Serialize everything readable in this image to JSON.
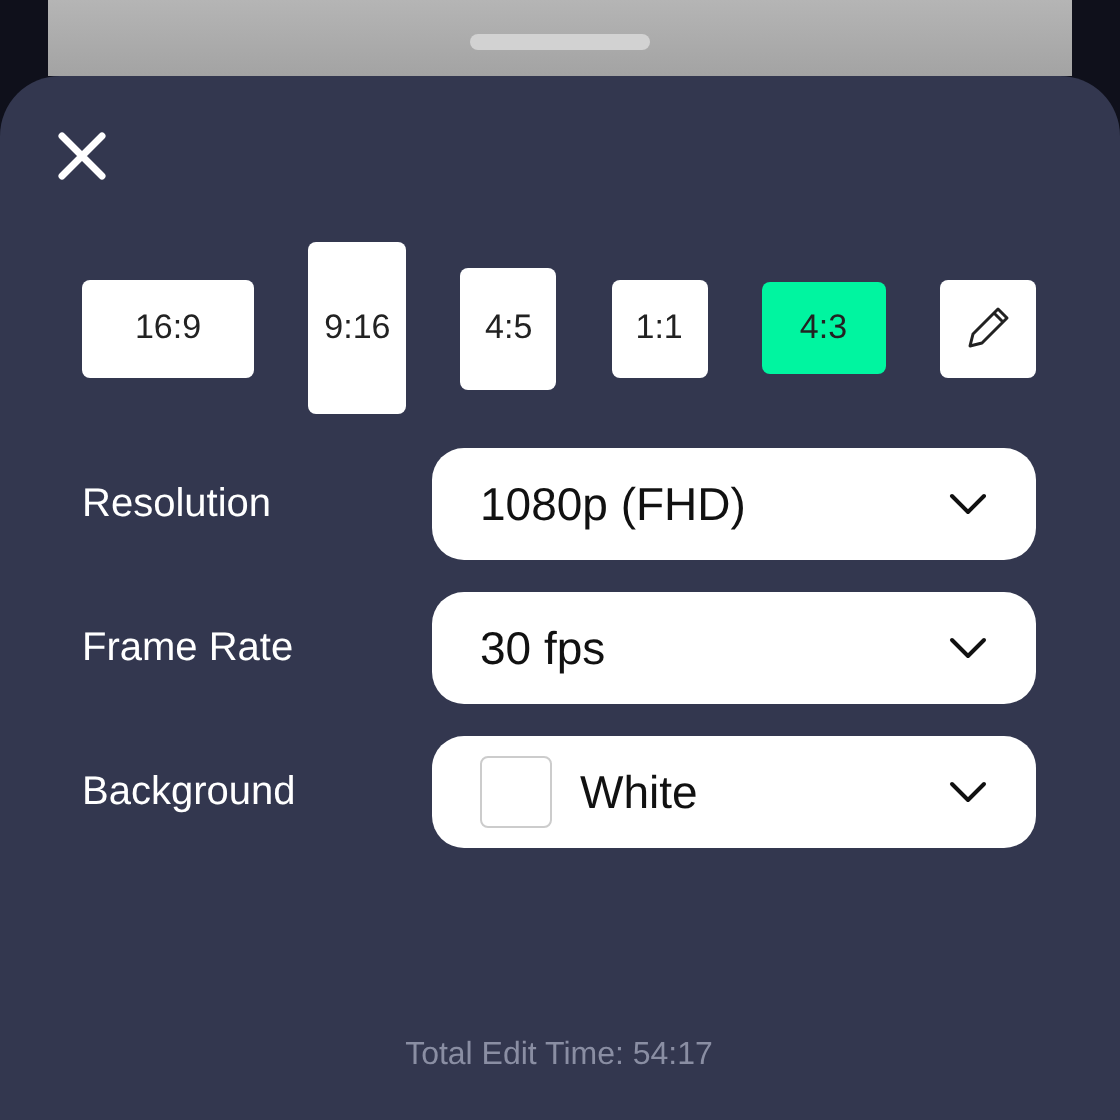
{
  "aspect_ratios": [
    {
      "kind": "ratio",
      "label": "16:9",
      "selected": false
    },
    {
      "kind": "ratio",
      "label": "9:16",
      "selected": false
    },
    {
      "kind": "ratio",
      "label": "4:5",
      "selected": false
    },
    {
      "kind": "ratio",
      "label": "1:1",
      "selected": false
    },
    {
      "kind": "ratio",
      "label": "4:3",
      "selected": true
    },
    {
      "kind": "custom",
      "selected": false
    }
  ],
  "settings": [
    {
      "label": "Resolution",
      "value": "1080p (FHD)"
    },
    {
      "label": "Frame Rate",
      "value": "30 fps"
    },
    {
      "label": "Background",
      "value": "White",
      "color": "#ffffff"
    }
  ],
  "footer": "Total Edit Time: 54:17"
}
